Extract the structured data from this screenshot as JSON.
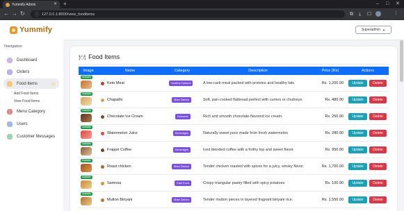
{
  "browser": {
    "tab_title": "Yummify Admin",
    "url": "127.0.0.1:8000/view_fooditems"
  },
  "app": {
    "logo_text": "Yummify",
    "user_menu": "Superadmin"
  },
  "sidebar": {
    "heading": "Navigation",
    "items": [
      {
        "label": "Dashboard",
        "icon": "dashboard-icon",
        "color": "#c9b8e6"
      },
      {
        "label": "Orders",
        "icon": "orders-icon",
        "color": "#b9b2e8"
      },
      {
        "label": "Food Items",
        "icon": "food-items-icon",
        "color": "#f2c87a"
      },
      {
        "label": "Menu Category",
        "icon": "menu-category-icon",
        "color": "#e58a8a"
      },
      {
        "label": "Users",
        "icon": "users-icon",
        "color": "#9fb8e6"
      },
      {
        "label": "Customer Messages",
        "icon": "messages-icon",
        "color": "#9ed3b0"
      }
    ],
    "subitems": [
      "Add Food Items",
      "View Food Items"
    ]
  },
  "page": {
    "title": "Food Items",
    "columns": [
      "Image",
      "Name",
      "Category",
      "Description",
      "Price (Rs)",
      "Actions"
    ],
    "availability_label": "Available",
    "update_label": "Update",
    "delete_label": "Delete",
    "rows": [
      {
        "name": "Keto Meal",
        "category": "Healthy Options",
        "description": "A low-carb meal packed with proteins and healthy fats",
        "price": "Rs. 1,200.00"
      },
      {
        "name": "Chapathi",
        "category": "Main Dishes",
        "description": "Soft, pan-cooked flatbread perfect with curries or chutneys.",
        "price": "Rs. 480.00"
      },
      {
        "name": "Chocolate Ice Cream",
        "category": "Desserts",
        "description": "Rich and smooth chocolate-flavored ice cream.",
        "price": "Rs. 250.00"
      },
      {
        "name": "Watermelon Juice",
        "category": "Beverages",
        "description": "Naturally sweet juice made from fresh watermelon",
        "price": "Rs. 280.00"
      },
      {
        "name": "Frappé Coffee",
        "category": "Beverages",
        "description": "Iced blended coffee with a frothy top and sweet flavor.",
        "price": "Rs. 950.00"
      },
      {
        "name": "Roast chicken",
        "category": "Main Dishes",
        "description": "Tender chicken roasted with spices for a juicy, smoky flavor.",
        "price": "Rs. 1,700.00"
      },
      {
        "name": "Samosa",
        "category": "Fast Food",
        "description": "Crispy triangular pastry filled with spicy potatoes",
        "price": "Rs. 100.00"
      },
      {
        "name": "Mutton Biriyani",
        "category": "Main Dishes",
        "description": "Tender mutton pieces in layered fragrant biriyani rice.",
        "price": "Rs. 1,550.00"
      }
    ]
  },
  "colors": {
    "header_blue": "#0d6efd",
    "badge_purple": "#7b4fe0",
    "available_green": "#1e9e49",
    "update_teal": "#17a2b8",
    "delete_red": "#dc3545"
  }
}
